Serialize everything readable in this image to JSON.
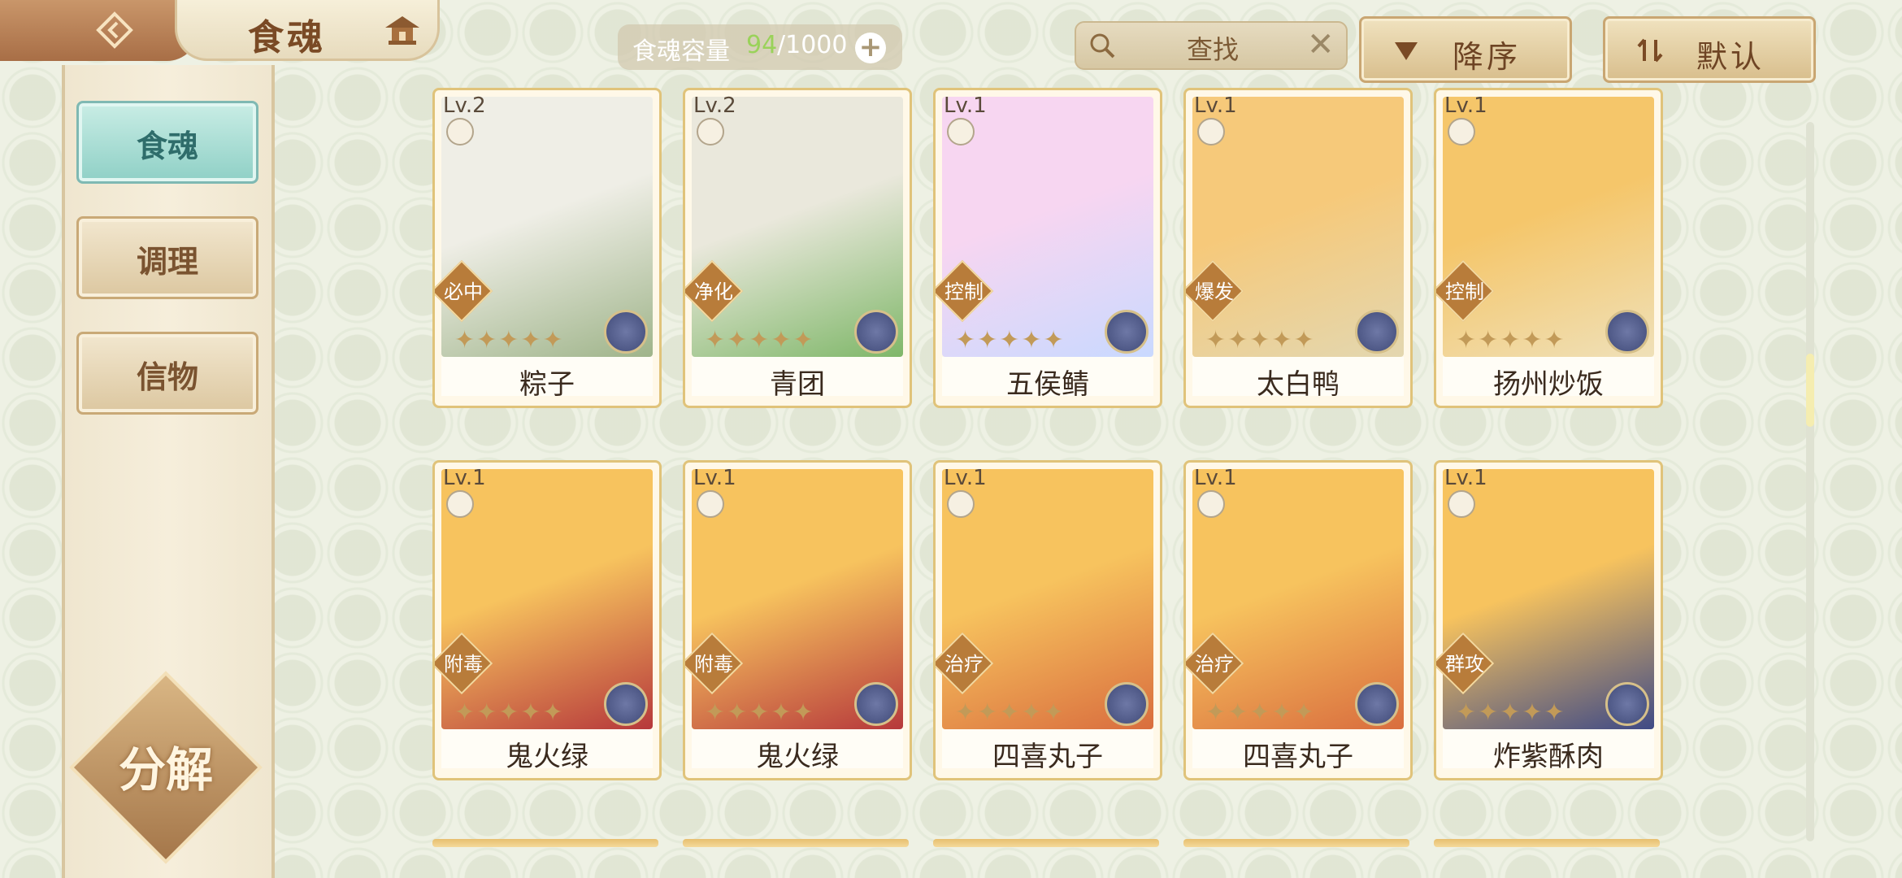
{
  "header": {
    "title": "食魂",
    "capacity": {
      "label": "食魂容量",
      "current": "94",
      "max": "/1000",
      "plus": "+"
    },
    "search": {
      "placeholder": "查找",
      "clear": "✕"
    },
    "sort_button": "降序",
    "default_button": "默认"
  },
  "sidebar": {
    "items": [
      {
        "label": "食魂",
        "active": true
      },
      {
        "label": "调理",
        "active": false
      },
      {
        "label": "信物",
        "active": false
      }
    ],
    "decompose": "分解"
  },
  "cards": [
    {
      "level": "Lv.2",
      "tag": "必中",
      "name": "粽子",
      "art_colors": [
        "#efeee6",
        "#9fb48a"
      ]
    },
    {
      "level": "Lv.2",
      "tag": "净化",
      "name": "青团",
      "art_colors": [
        "#eae8dc",
        "#7fb769"
      ]
    },
    {
      "level": "Lv.1",
      "tag": "控制",
      "name": "五侯鲭",
      "art_colors": [
        "#f7d6f1",
        "#c9d9ff"
      ]
    },
    {
      "level": "Lv.1",
      "tag": "爆发",
      "name": "太白鸭",
      "art_colors": [
        "#f6c97a",
        "#e3d7b0"
      ]
    },
    {
      "level": "Lv.1",
      "tag": "控制",
      "name": "扬州炒饭",
      "art_colors": [
        "#f5c66a",
        "#efe0b8"
      ]
    },
    {
      "level": "Lv.1",
      "tag": "附毒",
      "name": "鬼火绿",
      "art_colors": [
        "#f7c35e",
        "#b6383b"
      ]
    },
    {
      "level": "Lv.1",
      "tag": "附毒",
      "name": "鬼火绿",
      "art_colors": [
        "#f7c35e",
        "#b6383b"
      ]
    },
    {
      "level": "Lv.1",
      "tag": "治疗",
      "name": "四喜丸子",
      "art_colors": [
        "#f7c35e",
        "#d96d3e"
      ]
    },
    {
      "level": "Lv.1",
      "tag": "治疗",
      "name": "四喜丸子",
      "art_colors": [
        "#f7c35e",
        "#d96d3e"
      ]
    },
    {
      "level": "Lv.1",
      "tag": "群攻",
      "name": "炸紫酥肉",
      "art_colors": [
        "#f7c35e",
        "#3f4a86"
      ]
    }
  ]
}
